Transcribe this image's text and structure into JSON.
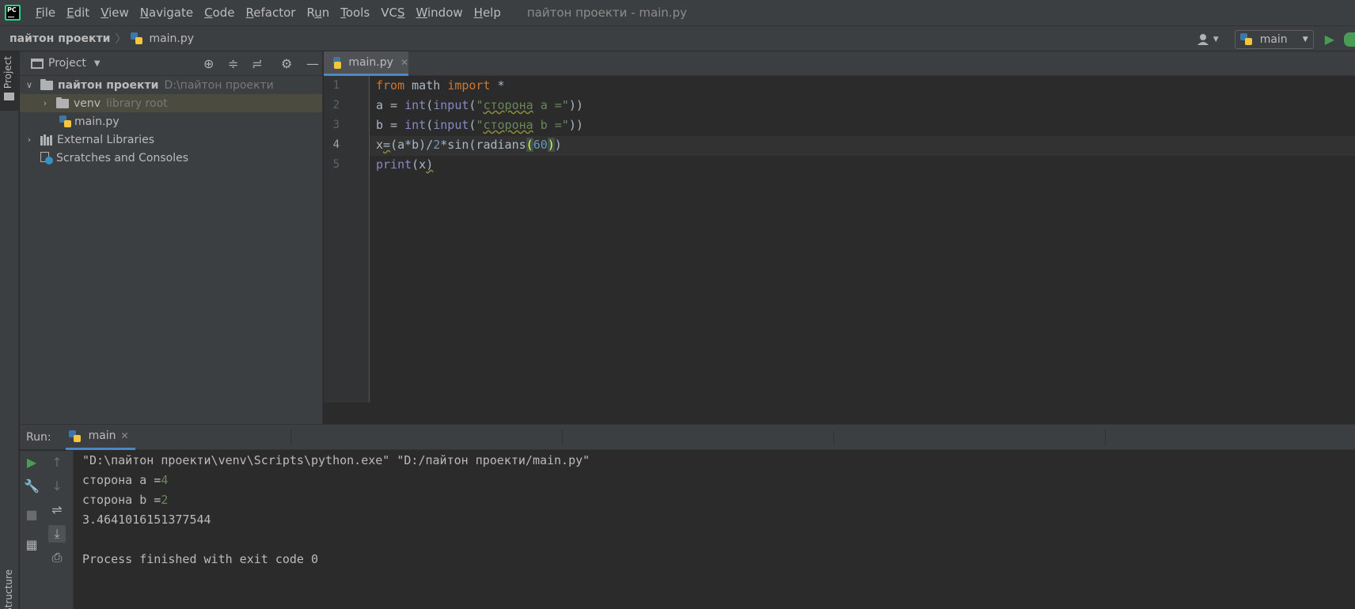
{
  "app": {
    "logo_text": "PC",
    "window_title": "пайтон проекти - main.py"
  },
  "menu": [
    {
      "label": "File",
      "mnemonic": "F",
      "rest": "ile"
    },
    {
      "label": "Edit",
      "mnemonic": "E",
      "rest": "dit"
    },
    {
      "label": "View",
      "mnemonic": "V",
      "rest": "iew"
    },
    {
      "label": "Navigate",
      "mnemonic": "N",
      "rest": "avigate"
    },
    {
      "label": "Code",
      "mnemonic": "C",
      "rest": "ode"
    },
    {
      "label": "Refactor",
      "mnemonic": "R",
      "rest": "efactor"
    },
    {
      "label": "Run",
      "pre": "R",
      "mnemonic": "u",
      "rest": "n"
    },
    {
      "label": "Tools",
      "mnemonic": "T",
      "rest": "ools"
    },
    {
      "label": "VCS",
      "pre": "VC",
      "mnemonic": "S",
      "rest": ""
    },
    {
      "label": "Window",
      "mnemonic": "W",
      "rest": "indow"
    },
    {
      "label": "Help",
      "mnemonic": "H",
      "rest": "elp"
    }
  ],
  "breadcrumb": {
    "project": "пайтон проекти",
    "separator": "〉",
    "file": "main.py"
  },
  "toolbar": {
    "run_config": "main"
  },
  "left_strip": {
    "project_label": "Project",
    "structure_label": "Structure"
  },
  "project_panel": {
    "title": "Project",
    "tree": {
      "root_name": "пайтон проекти",
      "root_path": "D:\\пайтон проекти",
      "venv_name": "venv",
      "venv_hint": "library root",
      "file_name": "main.py",
      "external_libraries": "External Libraries",
      "scratches": "Scratches and Consoles"
    }
  },
  "editor": {
    "tab_label": "main.py",
    "line_numbers": [
      "1",
      "2",
      "3",
      "4",
      "5"
    ],
    "current_line": 4,
    "code": {
      "l1_from": "from",
      "l1_mod": " math ",
      "l1_import": "import",
      "l1_star": " *",
      "l2_a": "a = ",
      "l2_int": "int",
      "l2_p1": "(",
      "l2_input": "input",
      "l2_p2": "(",
      "l2_q1": "\"",
      "l2_word": "сторона",
      "l2_str_rest": " a =\"",
      "l2_close": "))",
      "l3_b": "b = ",
      "l3_int": "int",
      "l3_p1": "(",
      "l3_input": "input",
      "l3_p2": "(",
      "l3_q1": "\"",
      "l3_word": "сторона",
      "l3_str_rest": " b =\"",
      "l3_close": "))",
      "l4_x": "x",
      "l4_eq": "=",
      "l4_expr": "(a*b)/",
      "l4_two": "2",
      "l4_mid": "*sin(radians",
      "l4_open": "(",
      "l4_sixty": "60",
      "l4_close_match": ")",
      "l4_close": ")",
      "l5_print": "print",
      "l5_open": "(x",
      "l5_close": ")"
    }
  },
  "run_panel": {
    "label": "Run:",
    "tab_label": "main",
    "console": {
      "command": "\"D:\\пайтон проекти\\venv\\Scripts\\python.exe\" \"D:/пайтон проекти/main.py\"",
      "prompt_a": "сторона a =",
      "input_a": "4",
      "prompt_b": "сторона b =",
      "input_b": "2",
      "result": "3.4641016151377544",
      "finished": "Process finished with exit code 0"
    }
  },
  "colors": {
    "background": "#2b2b2b",
    "panel": "#3c3f41",
    "accent": "#4a88c7",
    "keyword": "#cc7832",
    "string": "#6a8759",
    "number": "#6897bb",
    "builtin": "#8888c6",
    "run_green": "#499c54"
  }
}
